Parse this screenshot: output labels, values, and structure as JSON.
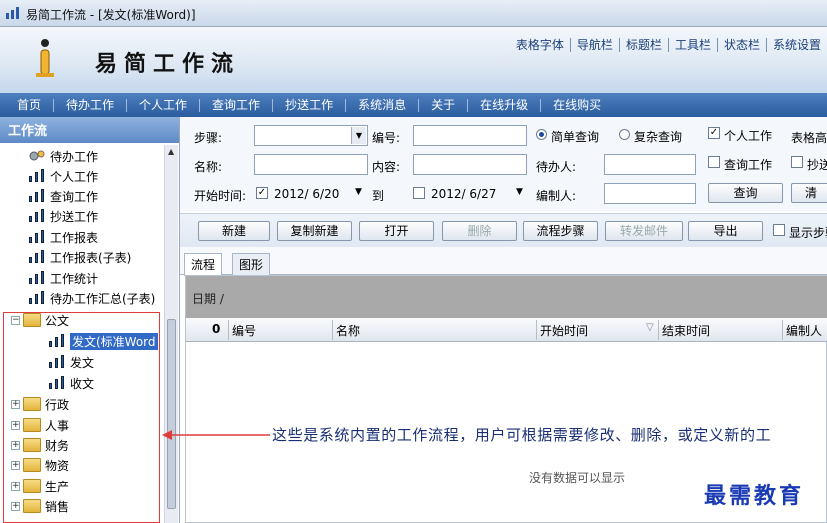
{
  "window": {
    "title": "易简工作流 - [发文(标准Word)]"
  },
  "app": {
    "title": "易简工作流"
  },
  "top_links": [
    "表格字体",
    "导航栏",
    "标题栏",
    "工具栏",
    "状态栏",
    "系统设置"
  ],
  "nav": [
    "首页",
    "待办工作",
    "个人工作",
    "查询工作",
    "抄送工作",
    "系统消息",
    "关于",
    "在线升级",
    "在线购买"
  ],
  "sidebar": {
    "title": "工作流",
    "items": [
      "待办工作",
      "个人工作",
      "查询工作",
      "抄送工作",
      "工作报表",
      "工作报表(子表)",
      "工作统计",
      "待办工作汇总(子表)"
    ],
    "folder_open": "公文",
    "sub_items": [
      "发文(标准Word",
      "发文",
      "收文"
    ],
    "folders": [
      "行政",
      "人事",
      "财务",
      "物资",
      "生产",
      "销售"
    ]
  },
  "filters": {
    "step": "步骤:",
    "number": "编号:",
    "name": "名称:",
    "content": "内容:",
    "start_time": "开始时间:",
    "date_from": "2012/ 6/20",
    "to": "到",
    "date_to": "2012/ 6/27",
    "simple_query": "简单查询",
    "complex_query": "复杂查询",
    "handler": "待办人:",
    "editor": "编制人:",
    "personal_work": "个人工作",
    "table_high": "表格高",
    "query_work": "查询工作",
    "cc": "抄送",
    "query_button": "查询",
    "clear_button": "清"
  },
  "toolbar": {
    "new": "新建",
    "copy_new": "复制新建",
    "open": "打开",
    "delete": "删除",
    "flow_steps": "流程步骤",
    "forward_mail": "转发邮件",
    "export": "导出",
    "show_steps": "显示步骤"
  },
  "tabs": [
    "流程",
    "图形"
  ],
  "grid": {
    "group_by": "日期 /",
    "columns": [
      "编号",
      "名称",
      "开始时间",
      "结束时间",
      "编制人"
    ],
    "empty": "没有数据可以显示"
  },
  "annotation": "这些是系统内置的工作流程，用户可根据需要修改、删除，或定义新的工",
  "watermark": "最需教育",
  "colors": {
    "nav": "#2a5d9e",
    "annotation": "#1a2e74",
    "watermark": "#1a3ab4",
    "highlight": "#e03c3c"
  }
}
